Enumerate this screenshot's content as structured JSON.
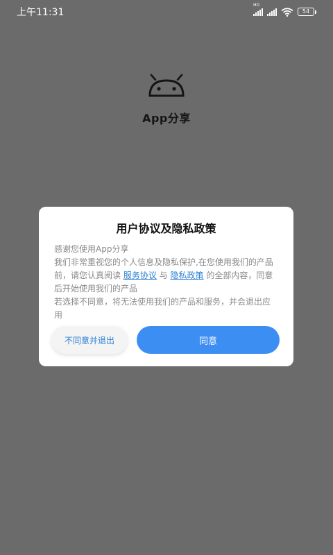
{
  "status_bar": {
    "time": "上午11:31",
    "battery": "54",
    "signal_label": "HD",
    "icons": [
      "hd-signal-icon",
      "signal-icon",
      "wifi-icon",
      "battery-icon"
    ]
  },
  "app": {
    "name": "App分享",
    "logo_icon": "android-robot-icon"
  },
  "dialog": {
    "title": "用户协议及隐私政策",
    "line_intro": "感谢您使用App分享",
    "line_p1_before": "我们非常重视您的个人信息及隐私保护,在您使用我们的产品前，请您认真阅读",
    "link_service": "服务协议",
    "conj": "与",
    "link_privacy": "隐私政策",
    "line_p1_after": "的全部内容，同意后开始使用我们的产品",
    "line_p2": "若选择不同意，将无法使用我们的产品和服务，并会退出应用",
    "decline_label": "不同意并退出",
    "accept_label": "同意"
  },
  "colors": {
    "backdrop": "#6b6b6b",
    "accent": "#3c8ef2",
    "link": "#2a7fd4"
  }
}
